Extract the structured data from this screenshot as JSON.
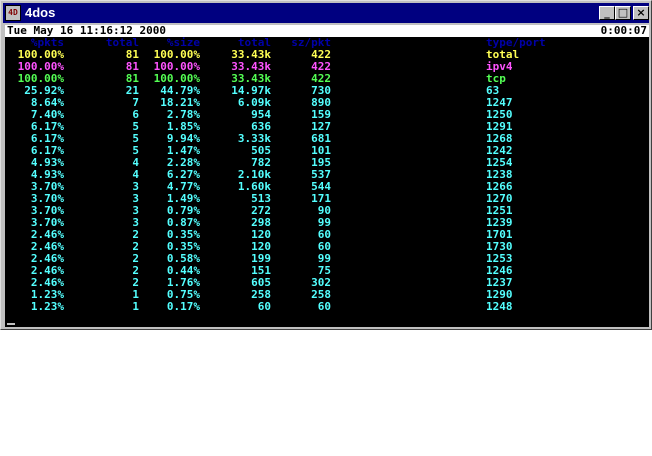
{
  "window": {
    "title": "4dos",
    "icon_text": "4D",
    "controls": {
      "minimize": "_",
      "maximize": "□",
      "close": "×"
    }
  },
  "status": {
    "datetime": "Tue May 16 11:16:12 2000",
    "elapsed": "0:00:07"
  },
  "colors": {
    "header": "#0000a8",
    "yellow": "#ffff54",
    "magenta": "#ff54ff",
    "green": "#54ff54",
    "cyan": "#54ffff"
  },
  "table": {
    "headers": [
      "%pkts",
      "total",
      "%size",
      "total",
      "sz/pkt",
      "type/port"
    ],
    "rows": [
      {
        "pkts": "100.00%",
        "total": "81",
        "size": "100.00%",
        "bytes": "33.43k",
        "szpkt": "422",
        "port": "total",
        "color": "yellow"
      },
      {
        "pkts": "100.00%",
        "total": "81",
        "size": "100.00%",
        "bytes": "33.43k",
        "szpkt": "422",
        "port": "ipv4",
        "color": "magenta"
      },
      {
        "pkts": "100.00%",
        "total": "81",
        "size": "100.00%",
        "bytes": "33.43k",
        "szpkt": "422",
        "port": "tcp",
        "color": "green"
      },
      {
        "pkts": "25.92%",
        "total": "21",
        "size": "44.79%",
        "bytes": "14.97k",
        "szpkt": "730",
        "port": "63",
        "color": "cyan"
      },
      {
        "pkts": "8.64%",
        "total": "7",
        "size": "18.21%",
        "bytes": "6.09k",
        "szpkt": "890",
        "port": "1247",
        "color": "cyan"
      },
      {
        "pkts": "7.40%",
        "total": "6",
        "size": "2.78%",
        "bytes": "954",
        "szpkt": "159",
        "port": "1250",
        "color": "cyan"
      },
      {
        "pkts": "6.17%",
        "total": "5",
        "size": "1.85%",
        "bytes": "636",
        "szpkt": "127",
        "port": "1291",
        "color": "cyan"
      },
      {
        "pkts": "6.17%",
        "total": "5",
        "size": "9.94%",
        "bytes": "3.33k",
        "szpkt": "681",
        "port": "1268",
        "color": "cyan"
      },
      {
        "pkts": "6.17%",
        "total": "5",
        "size": "1.47%",
        "bytes": "505",
        "szpkt": "101",
        "port": "1242",
        "color": "cyan"
      },
      {
        "pkts": "4.93%",
        "total": "4",
        "size": "2.28%",
        "bytes": "782",
        "szpkt": "195",
        "port": "1254",
        "color": "cyan"
      },
      {
        "pkts": "4.93%",
        "total": "4",
        "size": "6.27%",
        "bytes": "2.10k",
        "szpkt": "537",
        "port": "1238",
        "color": "cyan"
      },
      {
        "pkts": "3.70%",
        "total": "3",
        "size": "4.77%",
        "bytes": "1.60k",
        "szpkt": "544",
        "port": "1266",
        "color": "cyan"
      },
      {
        "pkts": "3.70%",
        "total": "3",
        "size": "1.49%",
        "bytes": "513",
        "szpkt": "171",
        "port": "1270",
        "color": "cyan"
      },
      {
        "pkts": "3.70%",
        "total": "3",
        "size": "0.79%",
        "bytes": "272",
        "szpkt": "90",
        "port": "1251",
        "color": "cyan"
      },
      {
        "pkts": "3.70%",
        "total": "3",
        "size": "0.87%",
        "bytes": "298",
        "szpkt": "99",
        "port": "1239",
        "color": "cyan"
      },
      {
        "pkts": "2.46%",
        "total": "2",
        "size": "0.35%",
        "bytes": "120",
        "szpkt": "60",
        "port": "1701",
        "color": "cyan"
      },
      {
        "pkts": "2.46%",
        "total": "2",
        "size": "0.35%",
        "bytes": "120",
        "szpkt": "60",
        "port": "1730",
        "color": "cyan"
      },
      {
        "pkts": "2.46%",
        "total": "2",
        "size": "0.58%",
        "bytes": "199",
        "szpkt": "99",
        "port": "1253",
        "color": "cyan"
      },
      {
        "pkts": "2.46%",
        "total": "2",
        "size": "0.44%",
        "bytes": "151",
        "szpkt": "75",
        "port": "1246",
        "color": "cyan"
      },
      {
        "pkts": "2.46%",
        "total": "2",
        "size": "1.76%",
        "bytes": "605",
        "szpkt": "302",
        "port": "1237",
        "color": "cyan"
      },
      {
        "pkts": "1.23%",
        "total": "1",
        "size": "0.75%",
        "bytes": "258",
        "szpkt": "258",
        "port": "1290",
        "color": "cyan"
      },
      {
        "pkts": "1.23%",
        "total": "1",
        "size": "0.17%",
        "bytes": "60",
        "szpkt": "60",
        "port": "1248",
        "color": "cyan"
      }
    ]
  }
}
